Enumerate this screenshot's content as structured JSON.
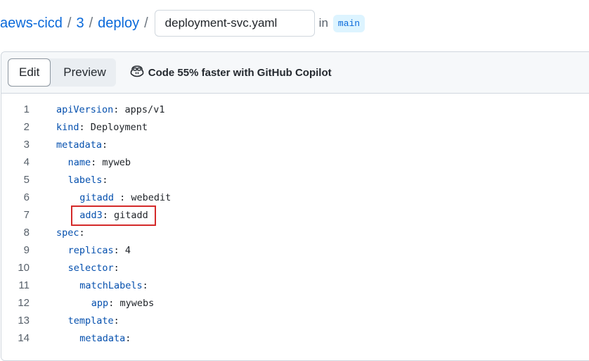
{
  "breadcrumb": {
    "repo": "aews-cicd",
    "folder1": "3",
    "folder2": "deploy",
    "separator": "/",
    "filename": "deployment-svc.yaml",
    "in_label": "in",
    "branch": "main"
  },
  "toolbar": {
    "edit_label": "Edit",
    "preview_label": "Preview",
    "copilot_text": "Code 55% faster with GitHub Copilot"
  },
  "code": [
    {
      "n": "1",
      "indent": 0,
      "key": "apiVersion",
      "val": " apps/v1"
    },
    {
      "n": "2",
      "indent": 0,
      "key": "kind",
      "val": " Deployment"
    },
    {
      "n": "3",
      "indent": 0,
      "key": "metadata",
      "val": ""
    },
    {
      "n": "4",
      "indent": 2,
      "key": "name",
      "val": " myweb"
    },
    {
      "n": "5",
      "indent": 2,
      "key": "labels",
      "val": ""
    },
    {
      "n": "6",
      "indent": 4,
      "key": "gitadd ",
      "val": " webedit"
    },
    {
      "n": "7",
      "indent": 4,
      "key": "add3",
      "val": " gitadd",
      "highlight": true
    },
    {
      "n": "8",
      "indent": 0,
      "key": "spec",
      "val": ""
    },
    {
      "n": "9",
      "indent": 2,
      "key": "replicas",
      "val": " 4"
    },
    {
      "n": "10",
      "indent": 2,
      "key": "selector",
      "val": ""
    },
    {
      "n": "11",
      "indent": 4,
      "key": "matchLabels",
      "val": ""
    },
    {
      "n": "12",
      "indent": 6,
      "key": "app",
      "val": " mywebs"
    },
    {
      "n": "13",
      "indent": 2,
      "key": "template",
      "val": ""
    },
    {
      "n": "14",
      "indent": 4,
      "key": "metadata",
      "val": ""
    }
  ],
  "colors": {
    "link": "#0969da",
    "yaml_key": "#0550ae",
    "highlight_box": "#d42a2a"
  },
  "icons": {
    "copilot": "copilot-icon"
  }
}
